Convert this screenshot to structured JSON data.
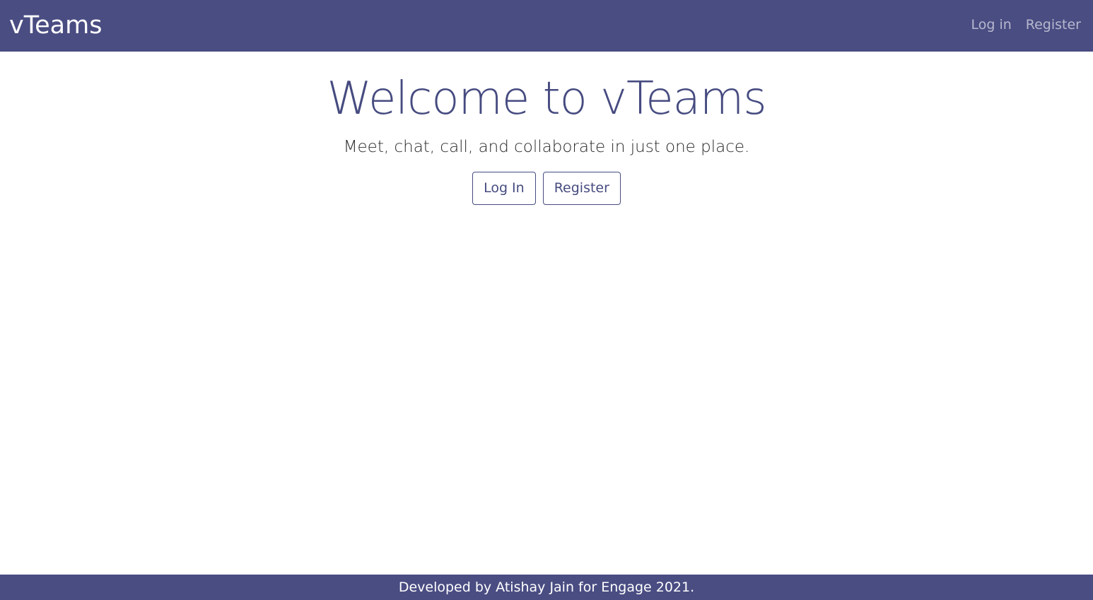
{
  "navbar": {
    "brand": "vTeams",
    "links": [
      {
        "label": "Log in"
      },
      {
        "label": "Register"
      }
    ]
  },
  "hero": {
    "title": "Welcome to vTeams",
    "subtitle": "Meet, chat, call, and collaborate in just one place.",
    "login_label": "Log In",
    "register_label": "Register"
  },
  "footer": {
    "text": "Developed by Atishay Jain for Engage 2021."
  },
  "colors": {
    "brand": "#4a4d82",
    "accent_text": "#464b80"
  }
}
